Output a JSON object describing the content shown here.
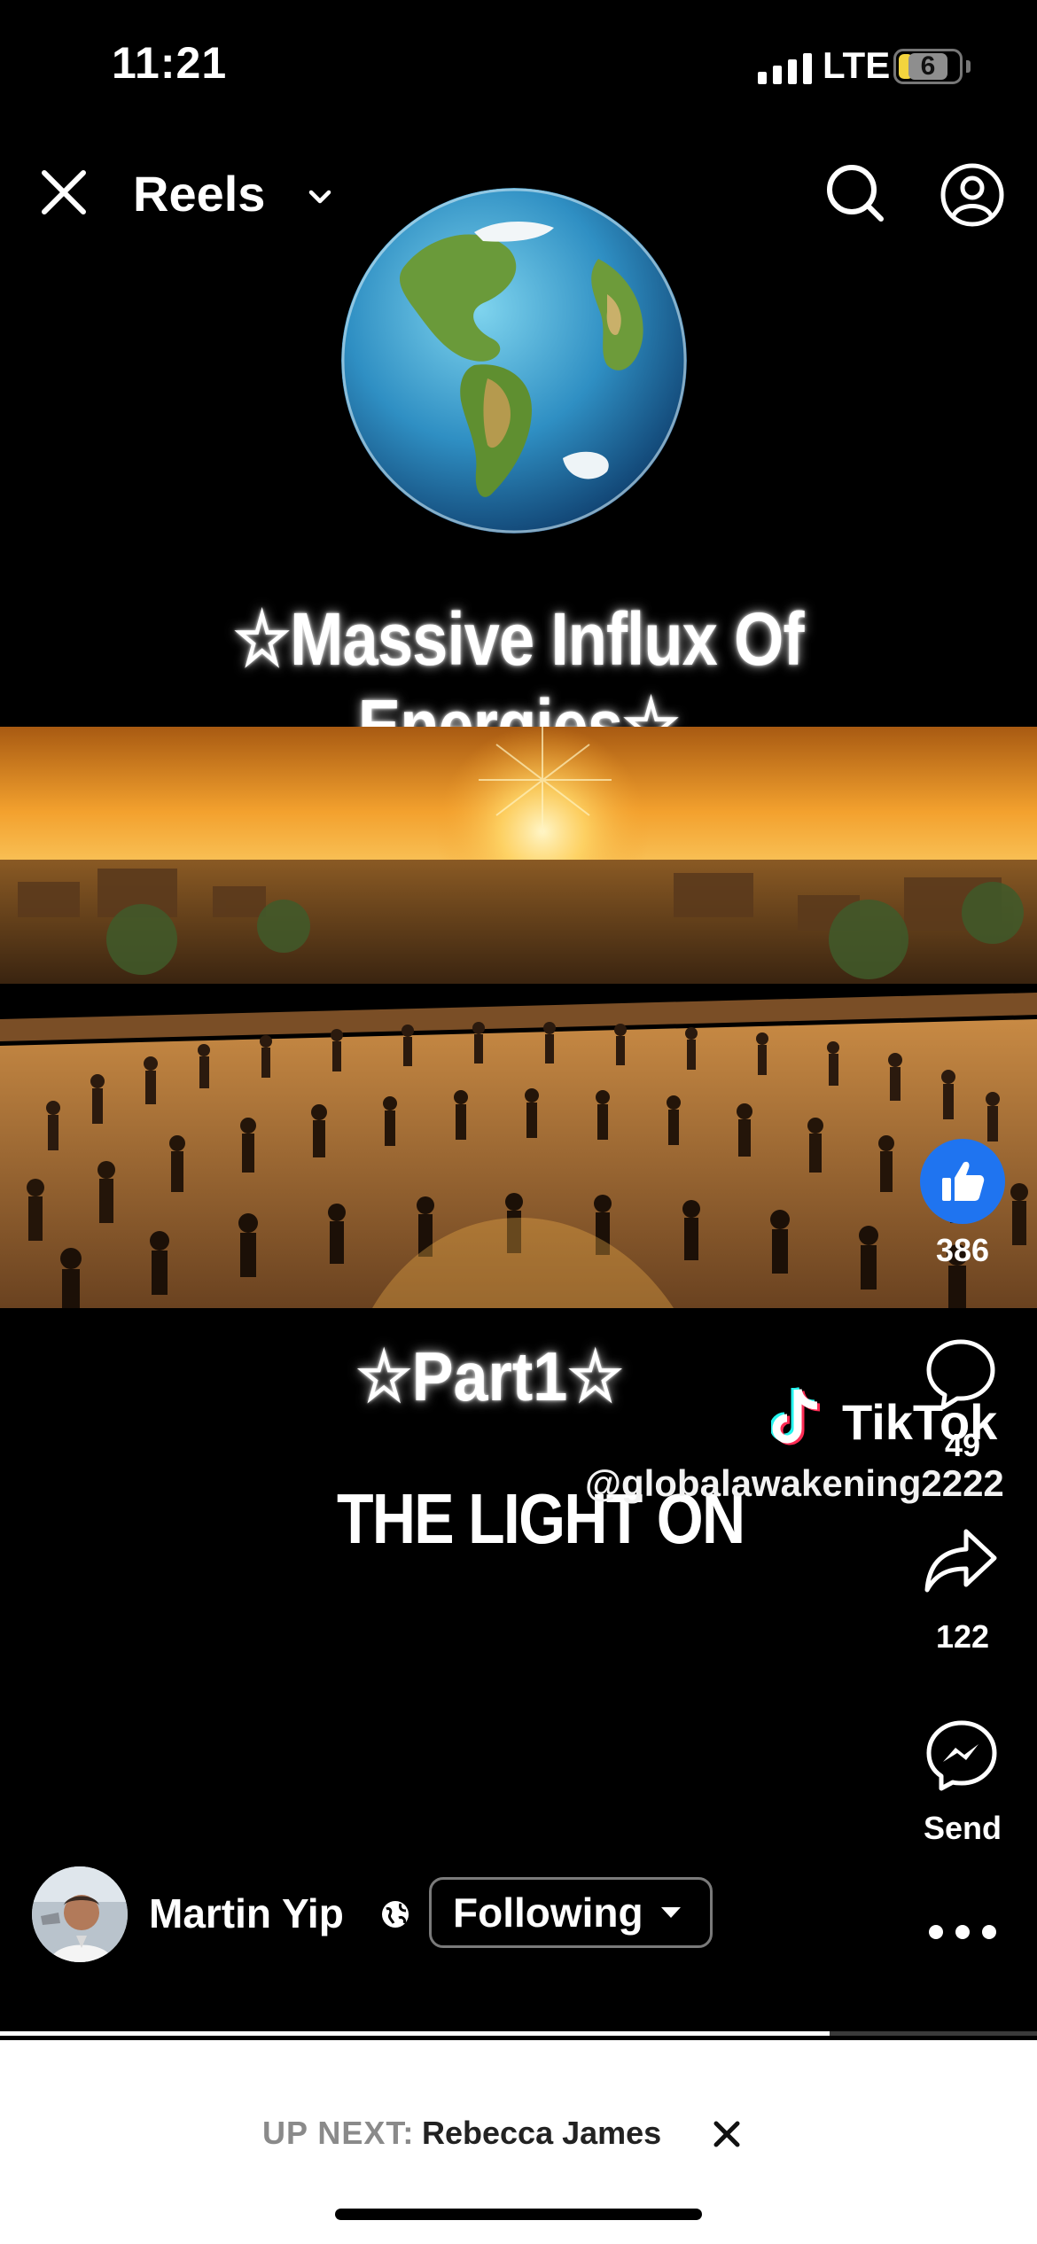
{
  "status_bar": {
    "time": "11:21",
    "network": "LTE",
    "battery_level": "6"
  },
  "header": {
    "title": "Reels"
  },
  "video": {
    "headline": "☆Massive Influx Of Energies☆",
    "part_text": "☆Part1☆",
    "overlay_text": "THE LIGHT ON",
    "watermark_brand": "TikTok",
    "watermark_handle": "@globalawakening2222"
  },
  "actions": {
    "like_count": "386",
    "comment_count": "49",
    "share_count": "122",
    "send_label": "Send"
  },
  "author": {
    "name": "Martin Yip",
    "follow_label": "Following"
  },
  "playback": {
    "progress": 0.8
  },
  "up_next": {
    "label": "UP NEXT:",
    "name": "Rebecca James"
  },
  "colors": {
    "like_blue": "#1f74f0",
    "background": "#000000",
    "tiktok_cyan": "#25f4ee",
    "tiktok_pink": "#fe2c55"
  }
}
